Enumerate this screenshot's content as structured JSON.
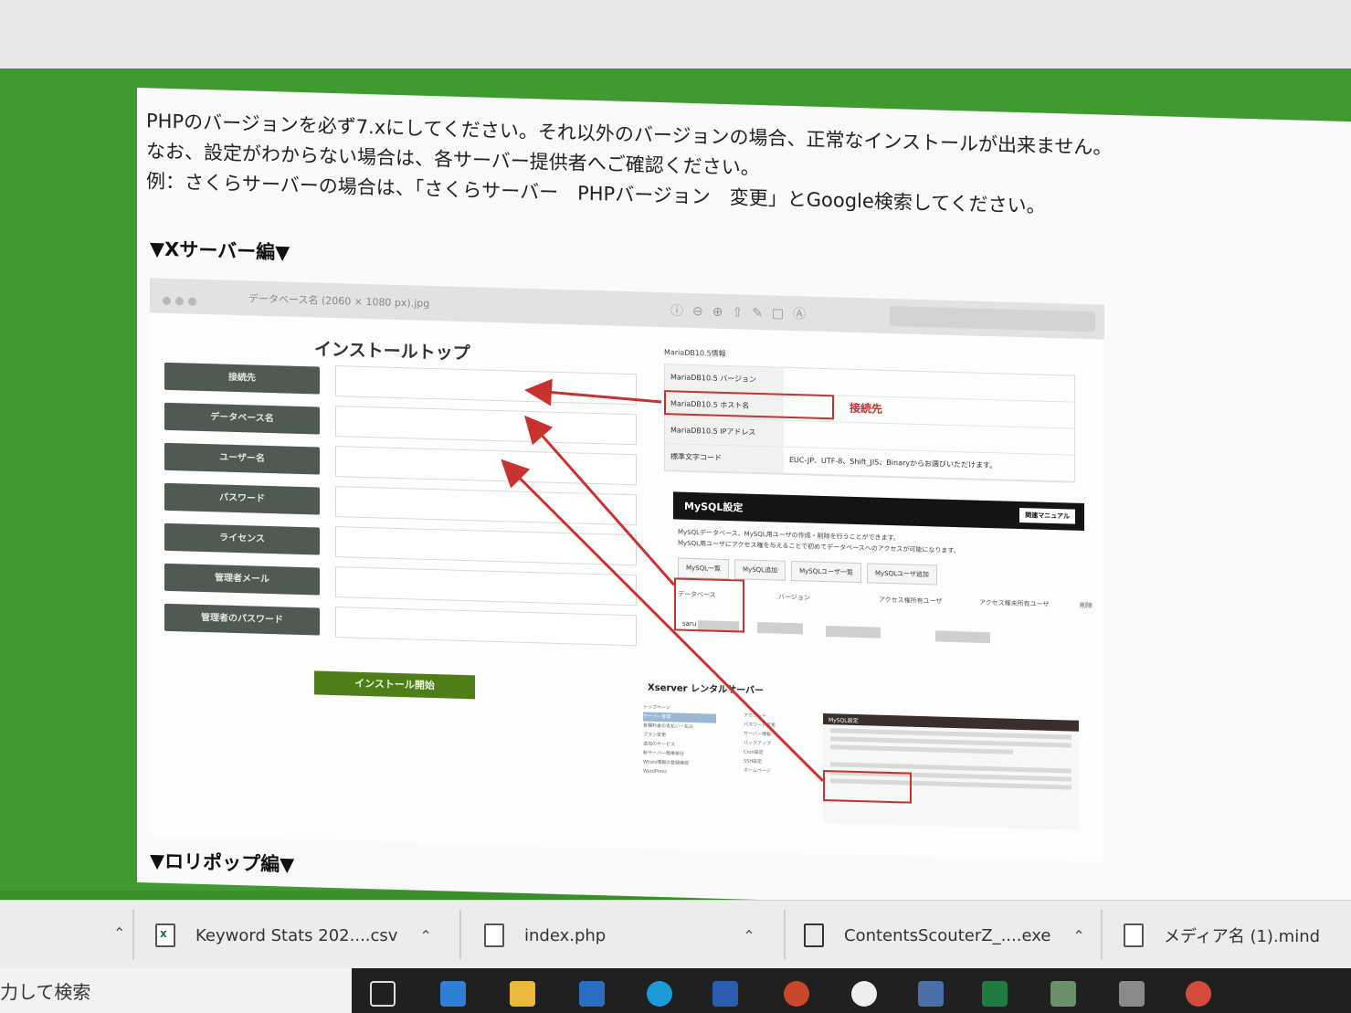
{
  "article": {
    "lines": [
      "PHPのバージョンを必ず7.xにしてください。それ以外のバージョンの場合、正常なインストールが出来ません。",
      "なお、設定がわからない場合は、各サーバー提供者へご確認ください。",
      "例：さくらサーバーの場合は、「さくらサーバー　PHPバージョン　変更」とGoogle検索してください。"
    ],
    "section_xserver": "▼Xサーバー編▼",
    "section_lolipop": "▼ロリポップ編▼"
  },
  "embed": {
    "filename": "データベース名 (2060 × 1080 px).jpg",
    "tools": "ⓘ⊖⊕⇧✎□Ⓐ",
    "install_title": "インストールトップ",
    "fields": [
      "接続先",
      "データベース名",
      "ユーザー名",
      "パスワード",
      "ライセンス",
      "管理者メール",
      "管理者のパスワード"
    ],
    "install_button": "インストール開始",
    "maria_title": "MariaDB10.5情報",
    "maria_rows": [
      {
        "key": "MariaDB10.5 バージョン",
        "value": ""
      },
      {
        "key": "MariaDB10.5 ホスト名",
        "value": ""
      },
      {
        "key": "MariaDB10.5 IPアドレス",
        "value": ""
      },
      {
        "key": "標準文字コード",
        "value": "EUC-JP、UTF-8、Shift_JIS、Binaryからお選びいただけます。"
      }
    ],
    "connection_label": "接続先",
    "mysql_title": "MySQL設定",
    "mysql_manual": "関連マニュアル",
    "mysql_desc": [
      "MySQLデータベース、MySQL用ユーザの作成・削除を行うことができます。",
      "MySQL用ユーザにアクセス権を与えることで初めてデータベースへのアクセスが可能になります。"
    ],
    "mysql_tabs": [
      "MySQL一覧",
      "MySQL追加",
      "MySQLユーザ一覧",
      "MySQLユーザ追加"
    ],
    "mysql_headers": [
      "データベース",
      "バージョン",
      "アクセス権所有ユーザ",
      "アクセス権未所有ユーザ",
      "削除"
    ],
    "mysql_db_prefix": "saru",
    "xserver_title": "Xserver レンタルサーバー",
    "xserver_side": [
      "トップページ",
      "サーバー管理",
      "各種料金の支払い・払込",
      "プラン変更",
      "追加のサービス",
      "新サーバー簡単移行",
      "Whois情報の登録確認",
      "WordPress"
    ],
    "xserver_mid": [
      "アカウント",
      "パスワード変更",
      "サーバー情報",
      "バックアップ",
      "Cron設定",
      "SSH設定",
      "ホームページ"
    ],
    "xserver_panel_title": "MySQL設定"
  },
  "downloads": [
    {
      "name": "Keyword Stats 202....csv",
      "icon": "csv-file-icon"
    },
    {
      "name": "index.php",
      "icon": "file-icon"
    },
    {
      "name": "ContentsScouterZ_....exe",
      "icon": "exe-file-icon"
    },
    {
      "name": "メディア名 (1).mind",
      "icon": "file-icon"
    }
  ],
  "taskbar": {
    "search_text": "力して検索"
  }
}
